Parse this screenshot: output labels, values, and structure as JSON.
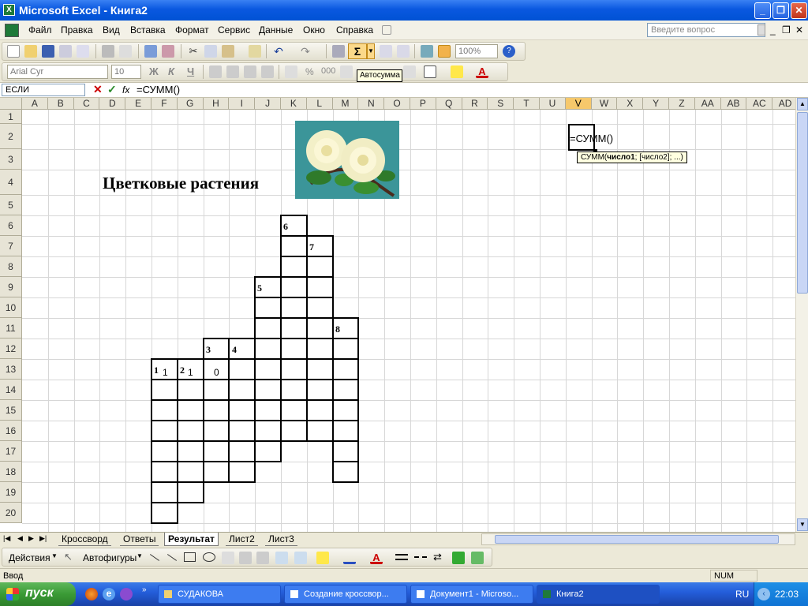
{
  "title_bar": {
    "title": "Microsoft Excel - Книга2",
    "min": "_",
    "restore": "❐",
    "close": "✕"
  },
  "menu": {
    "items": [
      "Файл",
      "Правка",
      "Вид",
      "Вставка",
      "Формат",
      "Сервис",
      "Данные",
      "Окно",
      "Справка"
    ],
    "ask_placeholder": "Введите вопрос",
    "doc_min": "_",
    "doc_restore": "❐",
    "doc_close": "✕"
  },
  "toolbar1": {
    "zoom": "100%",
    "tooltip": "Автосумма",
    "sigma": "Σ"
  },
  "toolbar2": {
    "font": "Arial Cyr",
    "size": "10",
    "bold": "Ж",
    "italic": "К",
    "underline": "Ч",
    "percent": "%",
    "thousands": "000"
  },
  "formula_bar": {
    "name_box": "ЕСЛИ",
    "cancel": "✕",
    "enter": "✓",
    "fx": "fx",
    "formula": "=СУММ()"
  },
  "grid": {
    "columns": [
      "A",
      "B",
      "C",
      "D",
      "E",
      "F",
      "G",
      "H",
      "I",
      "J",
      "K",
      "L",
      "M",
      "N",
      "O",
      "P",
      "Q",
      "R",
      "S",
      "T",
      "U",
      "V",
      "W",
      "X",
      "Y",
      "Z",
      "AA",
      "AB",
      "AC",
      "AD"
    ],
    "rows": [
      "1",
      "2",
      "3",
      "4",
      "5",
      "6",
      "7",
      "8",
      "9",
      "10",
      "11",
      "12",
      "13",
      "14",
      "15",
      "16",
      "17",
      "18",
      "19",
      "20"
    ],
    "selected_column": "V",
    "heading": "Цветковые растения",
    "active_cell_text": "=СУММ()",
    "function_hint_prefix": "СУММ(",
    "function_hint_bold": "число1",
    "function_hint_suffix": "; [число2]; ...)",
    "clue_numbers": [
      "1",
      "2",
      "3",
      "4",
      "5",
      "6",
      "7",
      "8"
    ],
    "cell_values": [
      "1",
      "1",
      "0"
    ]
  },
  "sheet_tabs": {
    "tabs": [
      "Кроссворд",
      "Ответы",
      "Результат",
      "Лист2",
      "Лист3"
    ],
    "active": "Результат"
  },
  "draw_toolbar": {
    "actions": "Действия",
    "autoshapes": "Автофигуры"
  },
  "status_bar": {
    "mode": "Ввод",
    "num": "NUM"
  },
  "taskbar": {
    "start": "пуск",
    "tasks": [
      "СУДАКОВА",
      "Создание кроссвор...",
      "Документ1 - Microso...",
      "Книга2"
    ],
    "lang": "RU",
    "clock": "22:03"
  },
  "colors": {
    "title_blue": "#0a58e0",
    "selection_orange": "#f6c86b",
    "start_green": "#3a9a35"
  }
}
